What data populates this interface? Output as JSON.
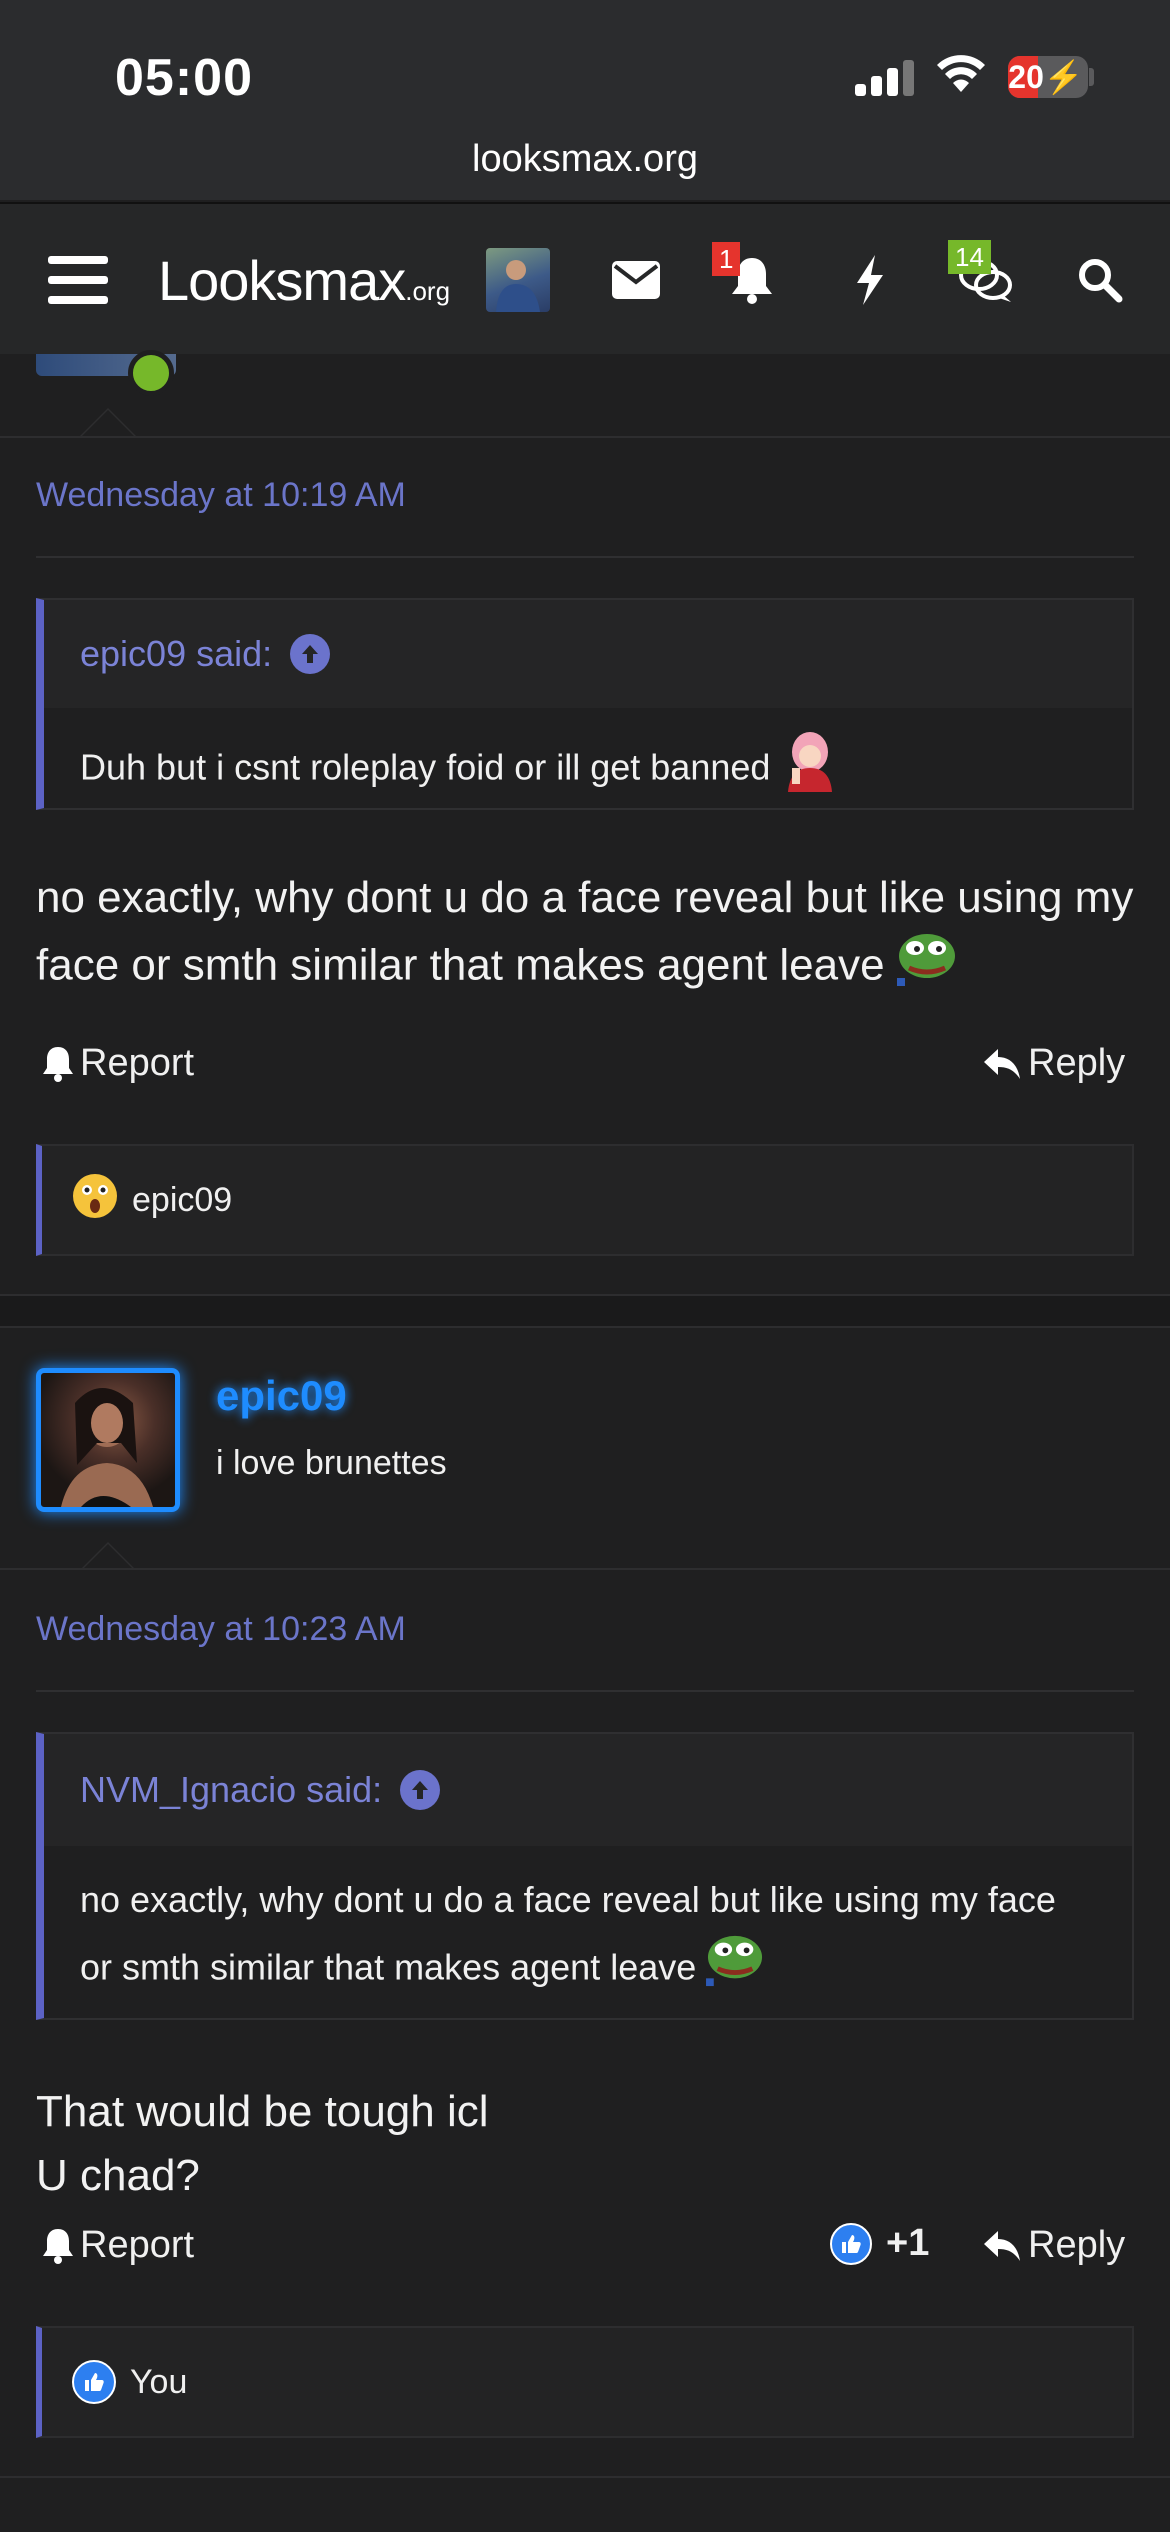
{
  "status_bar": {
    "time": "05:00",
    "battery": "20",
    "url": "looksmax.org"
  },
  "navbar": {
    "logo_main": "Looksmax",
    "logo_suffix": ".org",
    "alerts_badge": "1",
    "conversations_badge": "14",
    "icons": [
      "menu-icon",
      "envelope-icon",
      "bell-icon",
      "lightning-icon",
      "chat-bubbles-icon",
      "search-icon"
    ]
  },
  "posts": [
    {
      "date": "Wednesday at 10:19 AM",
      "quote_author": "epic09 said:",
      "quote_text": "Duh but i csnt roleplay foid or ill get banned",
      "message": "no exactly, why dont u do a face reveal but like using my face or smth similar that makes agent leave",
      "report_label": "Report",
      "reply_label": "Reply",
      "reaction_user": "epic09"
    },
    {
      "author": "epic09",
      "user_title": "i love brunettes",
      "date": "Wednesday at 10:23 AM",
      "quote_author": "NVM_Ignacio said:",
      "quote_text": "no exactly, why dont u do a face reveal but like using my face or smth similar that makes agent leave",
      "message_line1": "That would be tough icl",
      "message_line2": "U chad?",
      "report_label": "Report",
      "like_count": "+1",
      "reply_label": "Reply",
      "reaction_user": "You"
    }
  ],
  "colors": {
    "accent": "#6b75c9",
    "username": "#1e8cff",
    "online": "#76b82a",
    "alert_badge": "#e5342d",
    "conv_badge": "#76b82a"
  }
}
